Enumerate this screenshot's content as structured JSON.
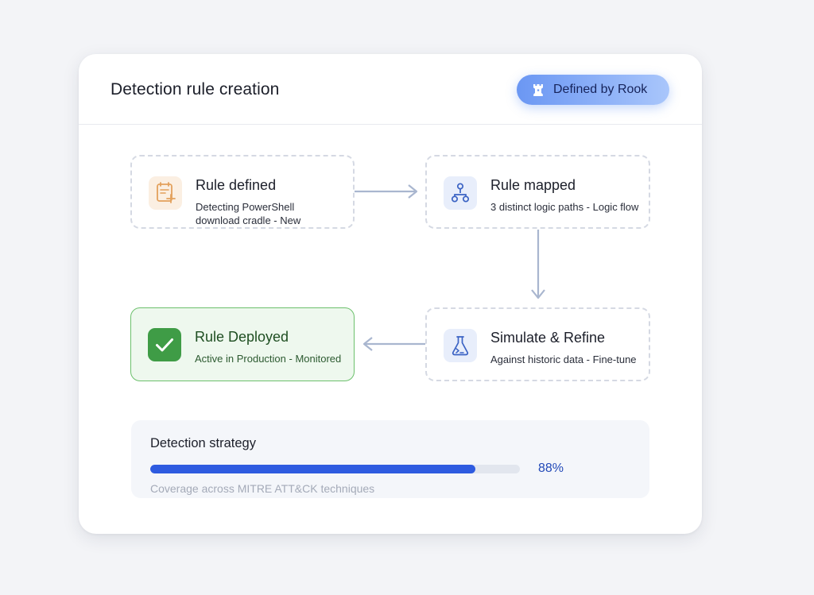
{
  "header": {
    "title": "Detection rule creation",
    "badge_label": "Defined by Rook",
    "badge_icon": "rook-icon"
  },
  "steps": [
    {
      "title": "Rule defined",
      "subtitle_lines": [
        "Detecting PowerShell",
        "download cradle - New"
      ],
      "icon": "document-plus-icon",
      "state": "pending"
    },
    {
      "title": "Rule mapped",
      "subtitle_lines": [
        "3 distinct logic paths - Logic flow"
      ],
      "icon": "hierarchy-icon",
      "state": "pending"
    },
    {
      "title": "Simulate & Refine",
      "subtitle_lines": [
        "Against historic data - Fine-tune"
      ],
      "icon": "flask-icon",
      "state": "pending"
    },
    {
      "title": "Rule Deployed",
      "subtitle_lines": [
        "Active in Production - Monitored"
      ],
      "icon": "checkmark-icon",
      "state": "complete"
    }
  ],
  "strategy": {
    "title": "Detection strategy",
    "progress_percent": 88,
    "progress_label": "88%",
    "caption": "Coverage across MITRE ATT&CK techniques"
  },
  "colors": {
    "accent_blue": "#2e5be0",
    "success_green": "#3f9c46",
    "orange_icon": "#e3a15c",
    "arrow_gray": "#a9b6cf"
  }
}
